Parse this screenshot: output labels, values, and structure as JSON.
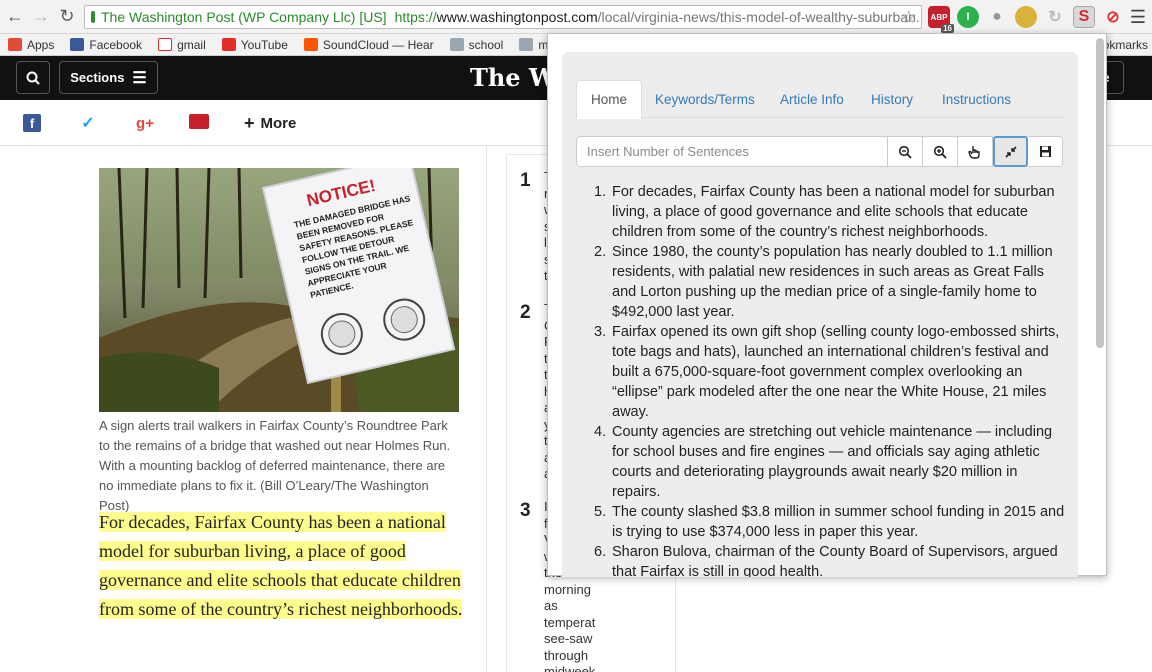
{
  "browser": {
    "ev_label": "The Washington Post (WP Company Llc) [US]",
    "url_scheme": "https://",
    "url_host": "www.washingtonpost.com",
    "url_path": "/local/virginia-news/this-model-of-wealthy-suburban...",
    "abp_badge": "ABP",
    "abp_count": "16"
  },
  "bookmarks": [
    {
      "label": "Apps",
      "icon": "apps-grid-icon",
      "color": "#e04b3a"
    },
    {
      "label": "Facebook",
      "icon": "facebook-icon",
      "color": "#3b5998"
    },
    {
      "label": "gmail",
      "icon": "gmail-icon",
      "color": "#d93025"
    },
    {
      "label": "YouTube",
      "icon": "youtube-icon",
      "color": "#e52d27"
    },
    {
      "label": "SoundCloud — Hear",
      "icon": "soundcloud-icon",
      "color": "#ff5500"
    },
    {
      "label": "school",
      "icon": "folder-icon",
      "color": "#9aa6b2"
    },
    {
      "label": "music",
      "icon": "folder-icon",
      "color": "#9aa6b2"
    }
  ],
  "bookmarks_overflow": "okmarks",
  "header": {
    "sections_label": "Sections",
    "logo_text": "The Wash",
    "right_button": "e"
  },
  "share": {
    "more_label": "More"
  },
  "article": {
    "caption": "A sign alerts trail walkers in Fairfax County’s Roundtree Park to the remains of a bridge that washed out near Holmes Run. With a mounting backlog of deferred maintenance, there are no immediate plans to fix it. (Bill O’Leary/The Washington Post)",
    "lede": "For decades, Fairfax County has been a national model for suburban living, a place of good governance and elite schools that educate children from some of the country’s richest neighborhoods.",
    "sign_title": "NOTICE!",
    "sign_text": "THE DAMAGED BRIDGE HAS BEEN REMOVED FOR SAFETY REASONS. PLEASE FOLLOW THE DETOUR SIGNS ON THE TRAIL. WE APPRECIATE YOUR PATIENCE."
  },
  "rail": {
    "items": [
      {
        "number": "1",
        "snippet": "T\nn\nw\ns\nl\ns\nt"
      },
      {
        "number": "2",
        "snippet": "T\nC\nF\nt\nt\nh\na\ny\nt\na\na"
      },
      {
        "number": "3",
        "snippet": "I\nf\nV\nw\nthe\nmorning\nas\ntemperat\nsee-saw\nthrough\nmidweek"
      }
    ]
  },
  "popup": {
    "tabs": [
      "Home",
      "Keywords/Terms",
      "Article Info",
      "History",
      "Instructions"
    ],
    "active_tab": "Home",
    "sentences_placeholder": "Insert Number of Sentences",
    "sentences_value": "",
    "summary": [
      "For decades, Fairfax County has been a national model for suburban living, a place of good governance and elite schools that educate children from some of the country’s richest neighborhoods.",
      "Since 1980, the county’s population has nearly doubled to 1.1 million residents, with palatial new residences in such areas as Great Falls and Lorton pushing up the median price of a single-family home to $492,000 last year.",
      "Fairfax opened its own gift shop (selling county logo-embossed shirts, tote bags and hats), launched an international children’s festival and built a 675,000-square-foot government complex overlooking an “ellipse” park modeled after the one near the White House, 21 miles away.",
      "County agencies are stretching out vehicle maintenance — including for school buses and fire engines — and officials say aging athletic courts and deteriorating playgrounds await nearly $20 million in repairs.",
      "The county slashed $3.8 million in summer school funding in 2015 and is trying to use $374,000 less in paper this year.",
      "Sharon Bulova, chairman of the County Board of Supervisors, argued that Fairfax is still in good health."
    ]
  }
}
